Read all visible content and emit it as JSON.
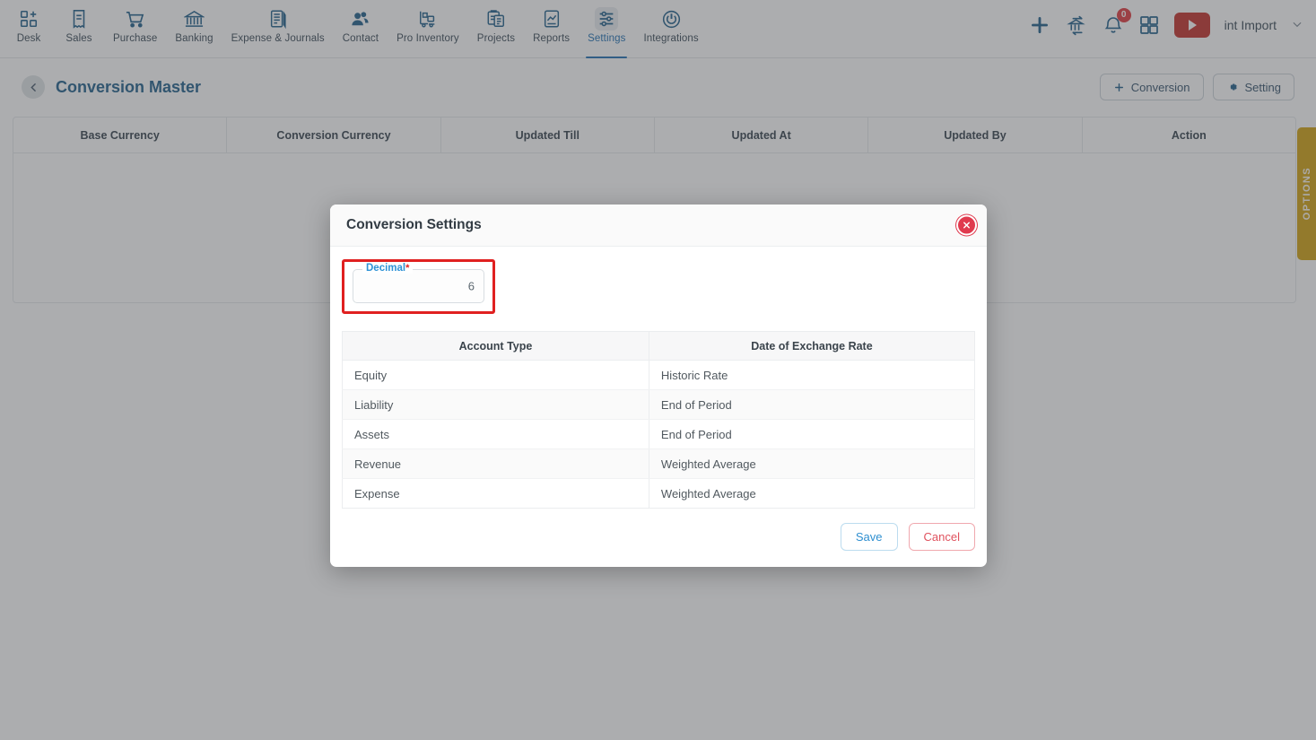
{
  "topnav": {
    "items": [
      {
        "label": "Desk",
        "icon": "dashboard-add-icon",
        "active": false
      },
      {
        "label": "Sales",
        "icon": "receipt-icon",
        "active": false
      },
      {
        "label": "Purchase",
        "icon": "shopping-cart-icon",
        "active": false
      },
      {
        "label": "Banking",
        "icon": "bank-icon",
        "active": false
      },
      {
        "label": "Expense & Journals",
        "icon": "journal-book-icon",
        "active": false
      },
      {
        "label": "Contact",
        "icon": "people-icon",
        "active": false
      },
      {
        "label": "Pro Inventory",
        "icon": "forklift-icon",
        "active": false
      },
      {
        "label": "Projects",
        "icon": "clipboard-plus-icon",
        "active": false
      },
      {
        "label": "Reports",
        "icon": "report-chart-icon",
        "active": false
      },
      {
        "label": "Settings",
        "icon": "sliders-icon",
        "active": true
      },
      {
        "label": "Integrations",
        "icon": "plug-power-icon",
        "active": false
      }
    ],
    "right": {
      "add_icon": "plus-icon",
      "transfer_icon": "bank-transfer-icon",
      "notification_icon": "bell-icon",
      "notification_count": "0",
      "apps_icon": "grid-apps-icon",
      "video_icon": "youtube-play-icon",
      "user_name": "int Import",
      "caret_icon": "chevron-down-icon"
    }
  },
  "page": {
    "back_icon": "chevron-left-icon",
    "title": "Conversion Master",
    "actions": [
      {
        "label": "Conversion",
        "icon": "plus-icon"
      },
      {
        "label": "Setting",
        "icon": "gear-icon"
      }
    ]
  },
  "background_table": {
    "columns": [
      "Base Currency",
      "Conversion Currency",
      "Updated Till",
      "Updated At",
      "Updated By",
      "Action"
    ],
    "rows": []
  },
  "options_tab": {
    "label": "OPTIONS"
  },
  "modal": {
    "title": "Conversion Settings",
    "close_icon": "close-x-icon",
    "decimal_field": {
      "label": "Decimal",
      "required_marker": "*",
      "value": "6"
    },
    "table": {
      "columns": [
        "Account Type",
        "Date of Exchange Rate"
      ],
      "rows": [
        [
          "Equity",
          "Historic Rate"
        ],
        [
          "Liability",
          "End of Period"
        ],
        [
          "Assets",
          "End of Period"
        ],
        [
          "Revenue",
          "Weighted Average"
        ],
        [
          "Expense",
          "Weighted Average"
        ]
      ]
    },
    "buttons": {
      "save": "Save",
      "cancel": "Cancel"
    }
  },
  "colors": {
    "brand_blue": "#1f5f8b",
    "accent_blue": "#2f8fd0",
    "danger_red": "#e03a4e",
    "highlight_red": "#e02020",
    "options_gold": "#d2a212",
    "youtube_red": "#c4302b"
  }
}
